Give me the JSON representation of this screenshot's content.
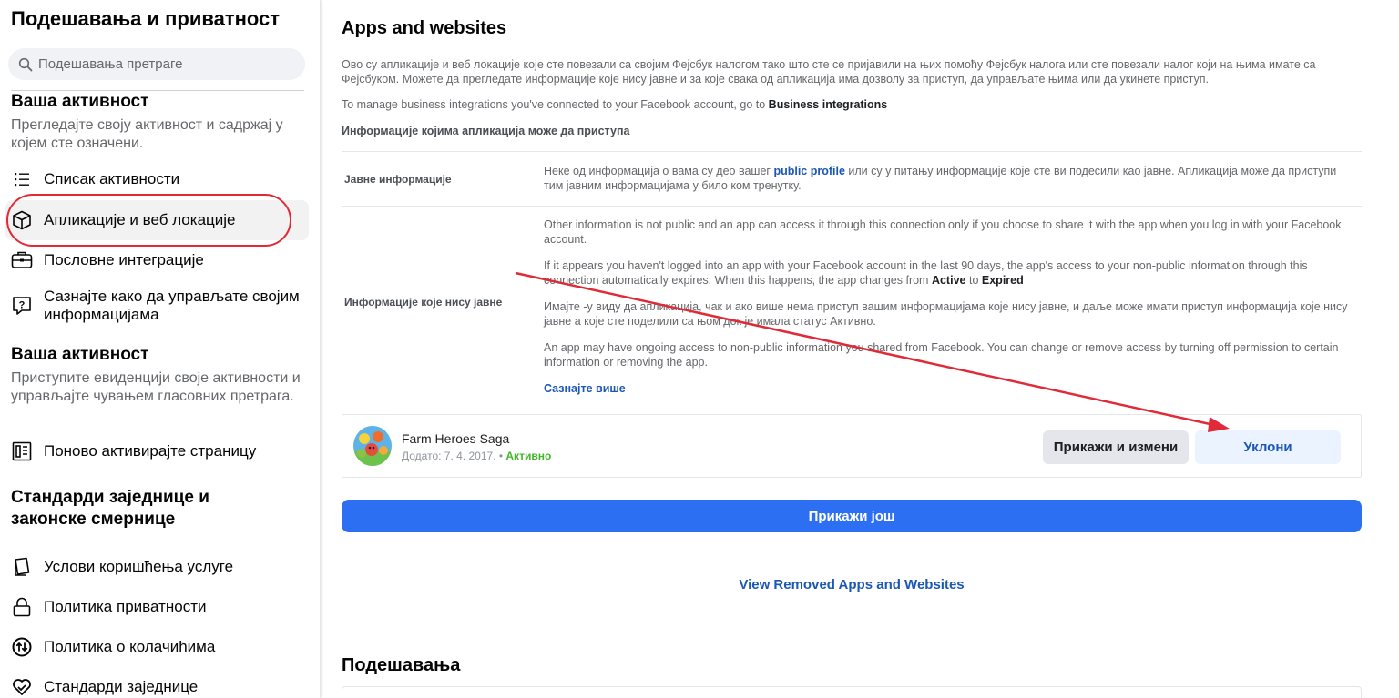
{
  "sidebar": {
    "title": "Подешавања и приватност",
    "search_placeholder": "Подешавања претраге",
    "section1": {
      "heading": "Ваша активност",
      "desc": "Прегледајте своју активност и садржај у којем сте означени.",
      "items": [
        {
          "label": "Списак активности",
          "icon": "list-icon"
        },
        {
          "label": "Апликације и веб локације",
          "icon": "cube-icon"
        },
        {
          "label": "Пословне интеграције",
          "icon": "briefcase-icon"
        },
        {
          "label": "Сазнајте како да управљате својим информацијама",
          "icon": "question-bubble-icon"
        }
      ]
    },
    "section2": {
      "heading": "Ваша активност",
      "desc": "Приступите евиденцији своје активности и управљајте чувањем гласовних претрага.",
      "items": [
        {
          "label": "Поново активирајте страницу",
          "icon": "page-icon"
        }
      ]
    },
    "section3": {
      "heading": "Стандарди заједнице и законске смернице",
      "items": [
        {
          "label": "Услови коришћења услуге",
          "icon": "book-icon"
        },
        {
          "label": "Политика приватности",
          "icon": "lock-icon"
        },
        {
          "label": "Политика о колачићима",
          "icon": "cookie-arrows-icon"
        },
        {
          "label": "Стандарди заједнице",
          "icon": "heart-hands-icon"
        }
      ]
    }
  },
  "main": {
    "title": "Apps and websites",
    "intro": "Ово су апликације и веб локације које сте повезали са својим Фејсбук налогом тако што сте се пријавили на њих помоћу Фејсбук налога или сте повезали налог који на њима имате са Фејсбуком. Можете да прегледате информације које нису јавне и за које свака од апликација има дозволу за приступ, да управљате њима или да укинете приступ.",
    "manage_text": "To manage business integrations you've connected to your Facebook account, go to",
    "manage_link": "Business integrations",
    "info_heading": "Информације којима апликација може да приступа",
    "public": {
      "label": "Јавне информације",
      "text_before": "Неке од информација о вама су део вашег",
      "link": "public profile",
      "text_after": "или су у питању информације које сте ви подесили као јавне. Апликација може да приступи тим јавним информацијама у било ком тренутку."
    },
    "nonpublic": {
      "label": "Информације које нису јавне",
      "p1": "Other information is not public and an app can access it through this connection only if you choose to share it with the app when you log in with your Facebook account.",
      "p2_before": "If it appears you haven't logged into an app with your Facebook account in the last 90 days, the app's access to your non-public information through this connection automatically expires. When this happens, the app changes from",
      "p2_active": "Active",
      "p2_to": "to",
      "p2_expired": "Expired",
      "p3": "Имајте -у виду да апликација, чак и ако више нема приступ вашим информацијама које нису јавне, и даље може имати приступ информација које нису јавне а које сте поделили са њом док је имала статус Активно.",
      "p4": "An app may have ongoing access to non-public information you shared from Facebook. You can change or remove access by turning off permission to certain information or removing the app.",
      "learn_more": "Сазнајте више"
    },
    "app": {
      "name": "Farm Heroes Saga",
      "added": "Додато: 7. 4. 2017.",
      "dot": "•",
      "status": "Активно",
      "view_button": "Прикажи и измени",
      "remove_button": "Уклони"
    },
    "show_more": "Прикажи још",
    "removed_link": "View Removed Apps and Websites",
    "settings_title": "Подешавања"
  },
  "colors": {
    "annotation_red": "#e02a38",
    "primary_blue": "#2d6ff2",
    "link_blue": "#1b57b5",
    "active_green": "#42b72a"
  }
}
